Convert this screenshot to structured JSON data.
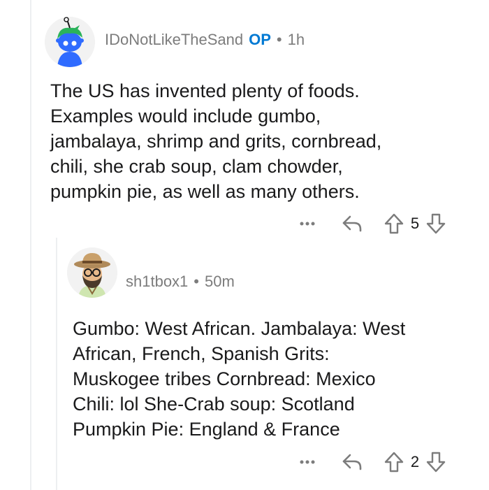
{
  "comments": [
    {
      "username": "IDoNotLikeTheSand",
      "op_label": "OP",
      "separator": "•",
      "time": "1h",
      "body_lines": [
        "The US has invented plenty of foods.",
        "Examples would include gumbo,",
        "jambalaya, shrimp and grits, cornbread,",
        "chili, she crab soup, clam chowder,",
        "pumpkin pie, as well as many others."
      ],
      "more_icon": "more-icon",
      "reply_icon": "reply-icon",
      "score": "5"
    },
    {
      "username": "sh1tbox1",
      "separator": "•",
      "time": "50m",
      "body_lines": [
        "Gumbo: West African. Jambalaya: West",
        "African, French, Spanish Grits:",
        "Muskogee tribes Cornbread: Mexico",
        "Chili: lol She-Crab soup: Scotland",
        "Pumpkin Pie: England & France"
      ],
      "more_icon": "more-icon",
      "reply_icon": "reply-icon",
      "score": "2"
    }
  ],
  "colors": {
    "op": "#0079d3",
    "meta": "#7c7c7c",
    "text": "#1a1a1b",
    "thread_line": "#edeff1"
  }
}
